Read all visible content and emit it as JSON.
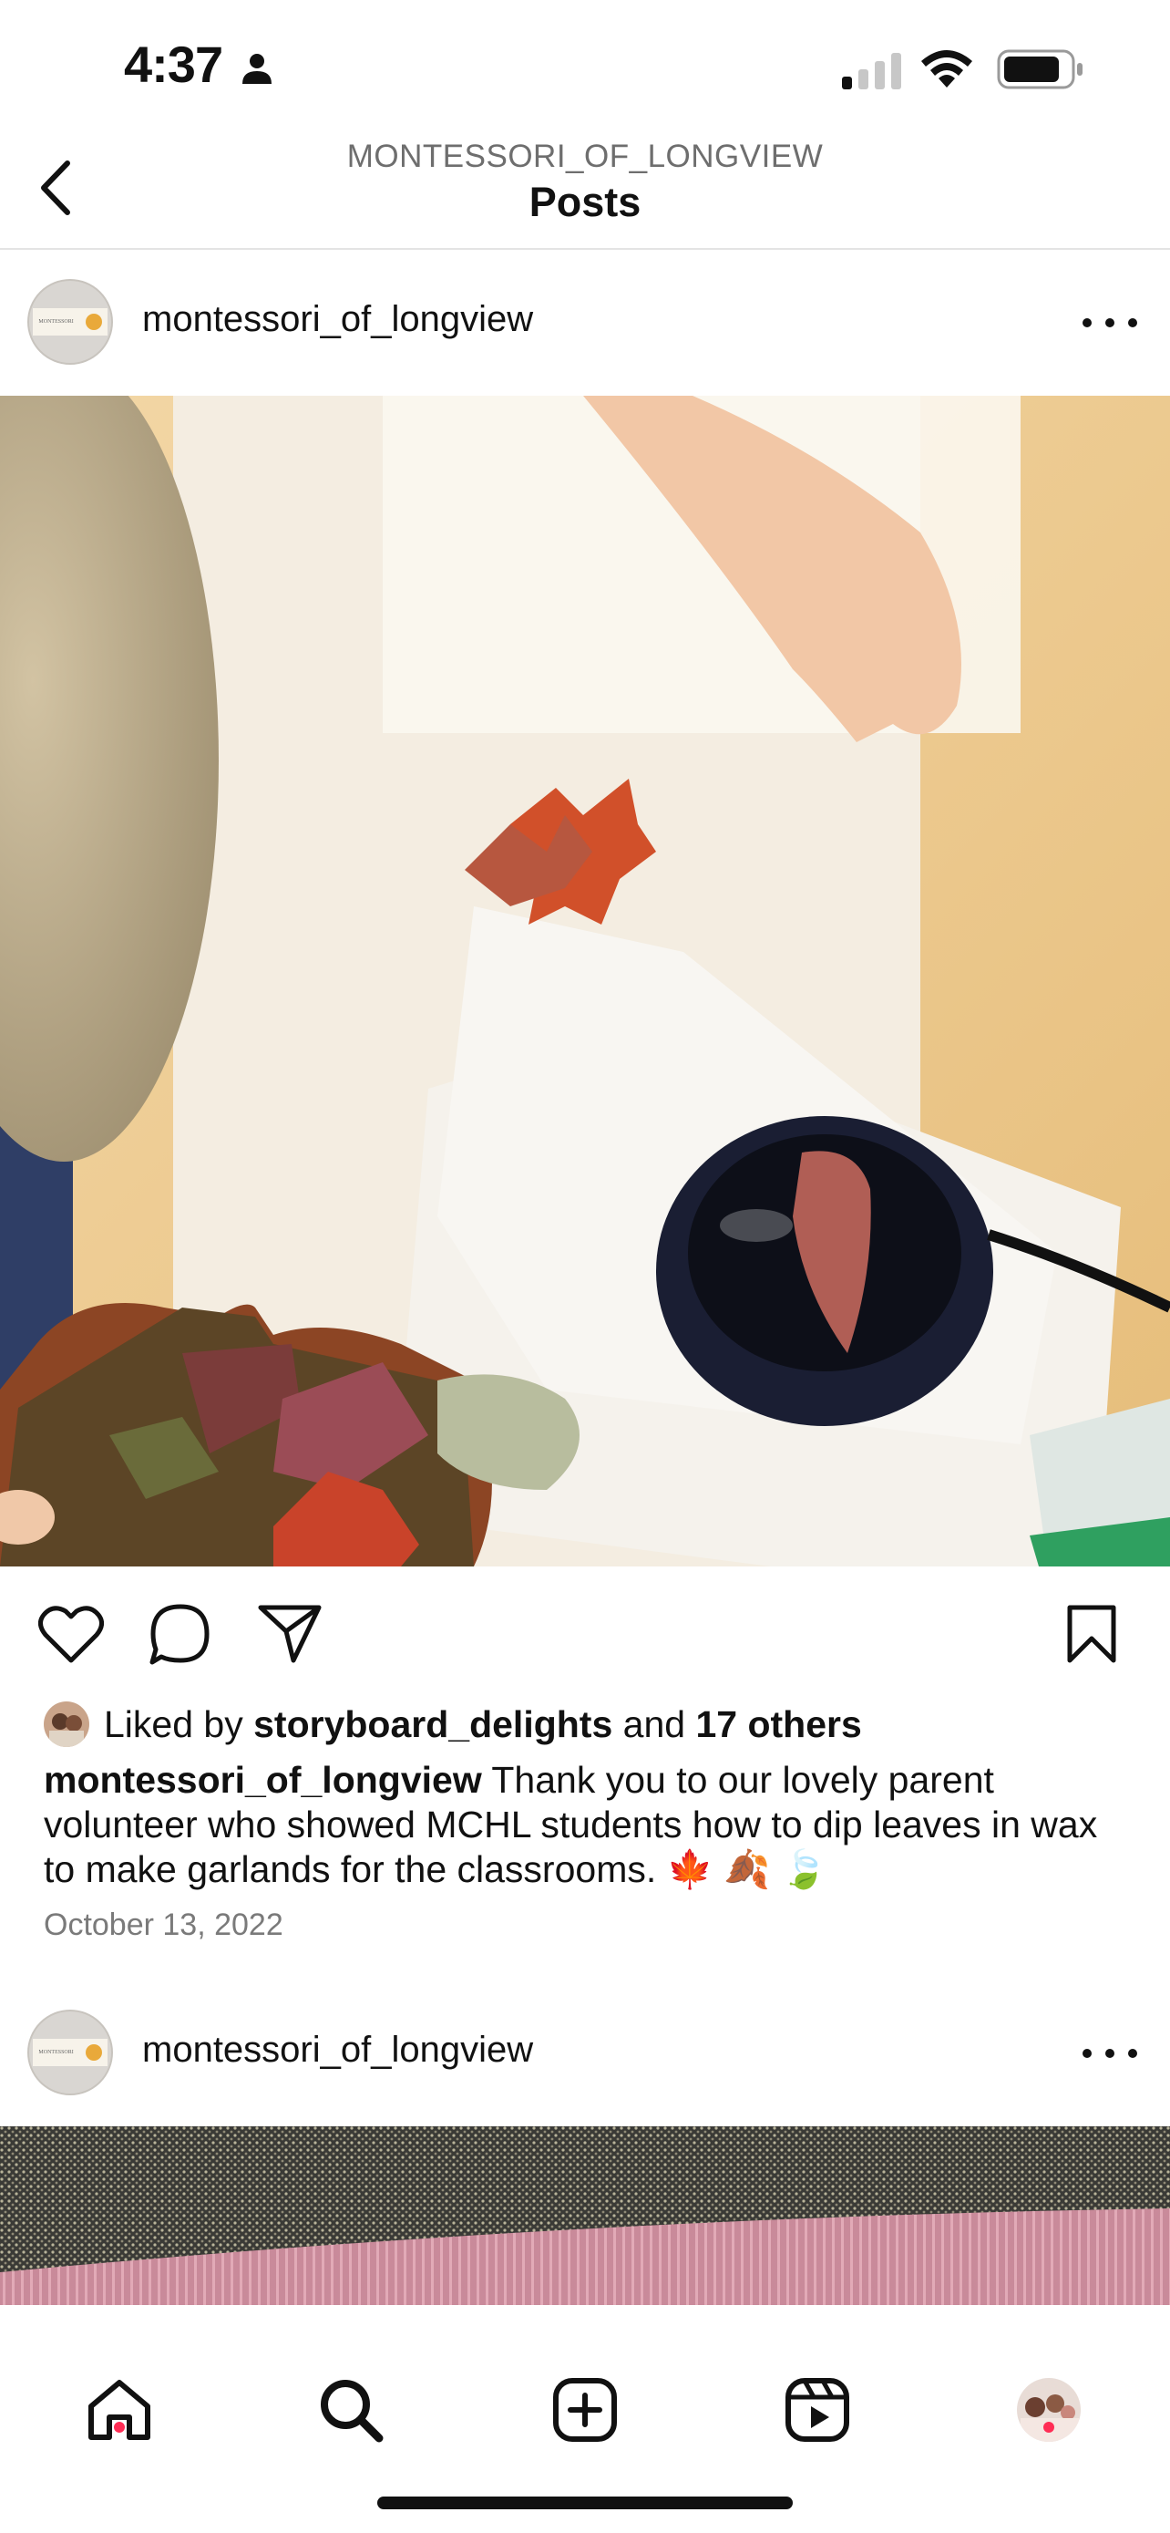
{
  "status_bar": {
    "time": "4:37"
  },
  "header": {
    "account": "MONTESSORI_OF_LONGVIEW",
    "title": "Posts"
  },
  "post": {
    "username": "montessori_of_longview",
    "avatar_label": "MONTESSORI",
    "photo_icon": "photo-leaves-wax-dipping",
    "likes": {
      "prefix": "Liked by",
      "liker": "storyboard_delights",
      "joiner": "and",
      "others": "17 others"
    },
    "caption": {
      "username": "montessori_of_longview",
      "text": "Thank you to our lovely parent volunteer who showed MCHL students how to dip leaves in wax to make garlands for the classrooms.",
      "emojis": "🍁 🍂 🍃"
    },
    "date": "October 13, 2022"
  },
  "next_post": {
    "username": "montessori_of_longview",
    "avatar_label": "MONTESSORI"
  },
  "tab_bar": {
    "items": [
      "home-icon",
      "search-icon",
      "create-post-icon",
      "reels-icon",
      "profile-avatar"
    ],
    "active": "search-icon"
  },
  "colors": {
    "notification_dot": "#ff2d55",
    "secondary_text": "#7a7a7a"
  }
}
